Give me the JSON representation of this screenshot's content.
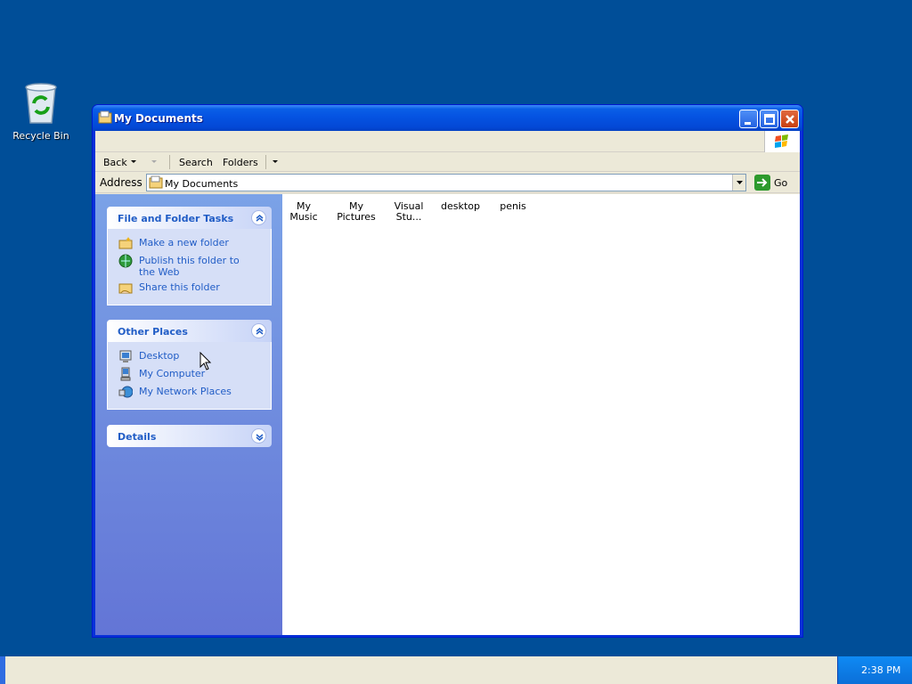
{
  "desktop": {
    "recycle_bin_label": "Recycle Bin"
  },
  "window": {
    "title": "My Documents",
    "colors": {
      "title_bar": "#0553e2",
      "task_pane": "#7ba2e7",
      "link": "#215dc6"
    }
  },
  "toolbar": {
    "back_label": "Back",
    "search_label": "Search",
    "folders_label": "Folders"
  },
  "address": {
    "label": "Address",
    "value": "My Documents",
    "go_label": "Go"
  },
  "file_tasks": {
    "title": "File and Folder Tasks",
    "items": [
      {
        "label": "Make a new folder",
        "icon": "new-folder-icon"
      },
      {
        "label": "Publish this folder to the Web",
        "icon": "globe-icon"
      },
      {
        "label": "Share this folder",
        "icon": "share-folder-icon"
      }
    ]
  },
  "other_places": {
    "title": "Other Places",
    "items": [
      {
        "label": "Desktop",
        "icon": "desktop-icon"
      },
      {
        "label": "My Computer",
        "icon": "my-computer-icon"
      },
      {
        "label": "My Network Places",
        "icon": "network-places-icon"
      }
    ]
  },
  "details": {
    "title": "Details"
  },
  "files": [
    {
      "line1": "My Music",
      "line2": ""
    },
    {
      "line1": "My Pictures",
      "line2": ""
    },
    {
      "line1": "Visual",
      "line2": "Stu..."
    },
    {
      "line1": "desktop",
      "line2": ""
    },
    {
      "line1": "penis",
      "line2": ""
    }
  ],
  "taskbar": {
    "clock": "2:38 PM"
  }
}
